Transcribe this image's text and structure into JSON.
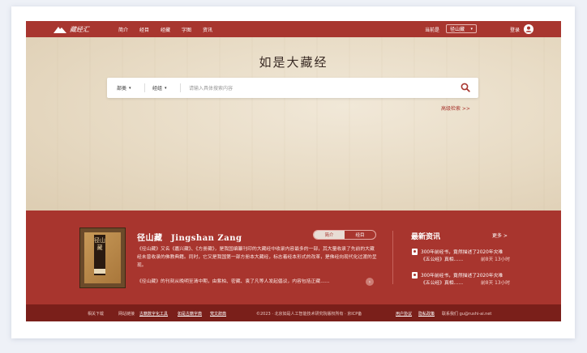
{
  "nav": {
    "logo_text": "藏经汇",
    "links": [
      "简介",
      "经目",
      "经藏",
      "字图",
      "资讯"
    ],
    "current_label": "当前是",
    "current_collection": "径山藏",
    "login": "登录"
  },
  "hero": {
    "title": "如是大藏经",
    "search": {
      "category": "部类",
      "group": "经组",
      "placeholder": "请输入具体搜索内容"
    },
    "advanced_search": "高级检索 >>"
  },
  "collection": {
    "cover_text": "径山藏",
    "name": "径山藏　Jingshan Zang",
    "tabs": [
      "简介",
      "经目"
    ],
    "active_tab": 0,
    "description": "《径山藏》又名《嘉兴藏》、《方册藏》，是我国编纂刊印的大藏经中收录内容最多的一部，其大量收录了先前的大藏经未曾收录的佛教典籍。同时，它又是我国第一部方册本大藏经，标志着经本形式的改革，是佛经向现代化过渡的呈现。",
    "description2": "《径山藏》的刊刻从晚明至清中期，由紫柏、密藏、袁了凡等人发起倡议，内容包括正藏……"
  },
  "news": {
    "title": "最新资讯",
    "more": "更多 >",
    "items": [
      {
        "line1": "300年前经书，竟然描述了2020年灾难",
        "line2": "《五公经》真相……",
        "time": "前8天 13小时"
      },
      {
        "line1": "300年前经书，竟然描述了2020年灾难",
        "line2": "《五公经》真相……",
        "time": "前8天 13小时"
      }
    ]
  },
  "footer": {
    "download": "相关下载",
    "links_label": "网站链接",
    "link1": "古籍数字化工具",
    "link2": "如是古籍字典",
    "link3": "梵文辞典",
    "copyright": "©2023 · 北京如是人工智能技术研究院版权所有 · 京ICP备",
    "agreement": "用户协议",
    "privacy": "隐私政策",
    "contact": "联系我们 gu@rushi-ai.net"
  },
  "colors": {
    "primary": "#a8362f",
    "footer": "#7a1f1a",
    "hero_bg": "#e7dac3"
  }
}
